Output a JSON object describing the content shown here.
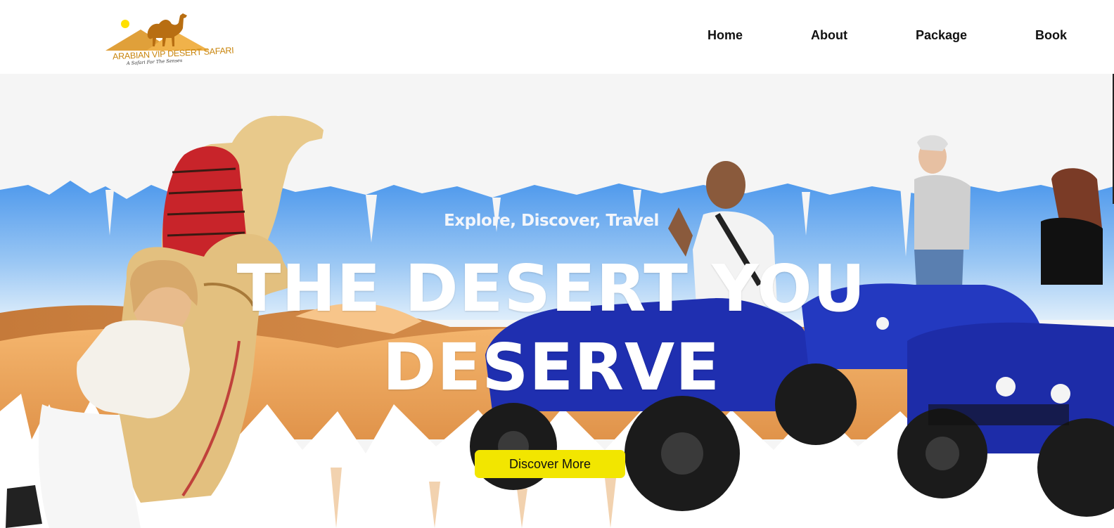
{
  "brand": {
    "name": "ARABIAN VIP DESERT SAFARI",
    "tagline": "A Safari For The Senses"
  },
  "nav": {
    "items": [
      {
        "label": "Home"
      },
      {
        "label": "About"
      },
      {
        "label": "Package"
      },
      {
        "label": "Book"
      }
    ]
  },
  "hero": {
    "subtitle": "Explore, Discover, Travel",
    "headline": "THE DESERT YOU DESERVE",
    "cta_label": "Discover More"
  },
  "colors": {
    "logo_gold": "#c9860f",
    "cta_yellow": "#f2e600",
    "sky_blue": "#5aa6f0",
    "sand": "#e9a45e",
    "quad_blue": "#1f2fb0"
  }
}
